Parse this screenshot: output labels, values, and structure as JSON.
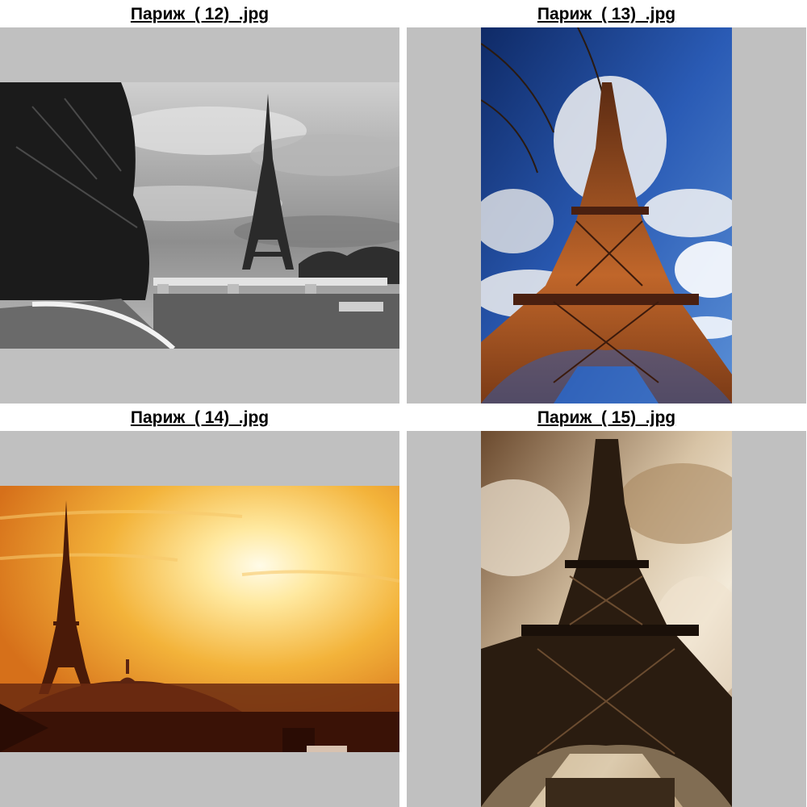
{
  "thumbnails": [
    {
      "filename": "Париж  ( 12)  .jpg",
      "orientation": "landscape",
      "style": "black-and-white",
      "colors": {
        "sky": "#9d9d9d",
        "tone": "#d6d6d6",
        "dark": "#1b1b1b",
        "ground": "#5c5c5c"
      }
    },
    {
      "filename": "Париж  ( 13)  .jpg",
      "orientation": "portrait",
      "style": "blue-sky",
      "colors": {
        "sky": "#173a84",
        "tone": "#f2f2f2",
        "dark": "#3b1a0c",
        "ground": "#c46a2c"
      }
    },
    {
      "filename": "Париж  ( 14)  .jpg",
      "orientation": "landscape",
      "style": "sunset",
      "colors": {
        "sky": "#e08a1d",
        "tone": "#fff6c6",
        "dark": "#3a1206",
        "ground": "#6b2a10"
      }
    },
    {
      "filename": "Париж  ( 15)  .jpg",
      "orientation": "portrait",
      "style": "sepia",
      "colors": {
        "sky": "#8a6440",
        "tone": "#efe3cf",
        "dark": "#1f140c",
        "ground": "#6b4c30"
      }
    }
  ]
}
